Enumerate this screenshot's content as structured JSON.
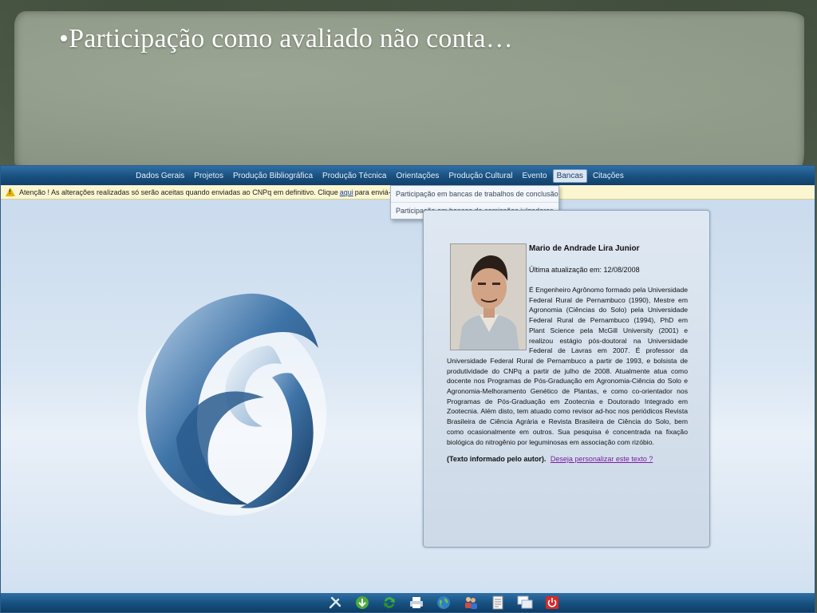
{
  "slide": {
    "title": "•Participação como avaliado não conta…"
  },
  "menu": {
    "items": [
      {
        "label": "Dados Gerais"
      },
      {
        "label": "Projetos"
      },
      {
        "label": "Produção Bibliográfica"
      },
      {
        "label": "Produção Técnica"
      },
      {
        "label": "Orientações"
      },
      {
        "label": "Produção Cultural"
      },
      {
        "label": "Evento"
      },
      {
        "label": "Bancas",
        "active": true
      },
      {
        "label": "Citações"
      }
    ],
    "dropdown": [
      "Participação em bancas de trabalhos de conclusão",
      "Participação em bancas de comissões julgadoras"
    ]
  },
  "notice": {
    "text_before": "Atenção ! As alterações realizadas só serão aceitas quando enviadas ao CNPq em definitivo. Clique",
    "link": "aqui",
    "text_after": "para enviá-las."
  },
  "profile": {
    "name": "Mario de Andrade Lira Junior",
    "updated": "Última atualização em: 12/08/2008",
    "bio": "É Engenheiro Agrônomo formado pela Universidade Federal Rural de Pernambuco (1990), Mestre em Agronomia (Ciências do Solo) pela Universidade Federal Rural de Pernambuco (1994), PhD em Plant Science pela McGill University (2001) e realizou estágio pós-doutoral na Universidade Federal de Lavras em 2007. É professor da Universidade Federal Rural de Pernambuco a partir de 1993, e bolsista de produtividade do CNPq a partir de julho de 2008. Atualmente atua como docente nos Programas de Pós-Graduação em Agronomia-Ciência do Solo e Agronomia-Melhoramento Genético de Plantas, e como co-orientador nos Programas de Pós-Graduação em Zootecnia e Doutorado Integrado em Zootecnia. Além disto, tem atuado como revisor ad-hoc nos periódicos Revista Brasileira de Ciência Agrária e Revista Brasileira de Ciência do Solo, bem como ocasionalmente em outros. Sua pesquisa é concentrada na fixação biológica do nitrogênio por leguminosas em associação com rizóbio.",
    "author_note": "(Texto informado pelo autor).",
    "personalize_link": "Deseja personalizar este texto ?"
  },
  "toolbar": {
    "icons": [
      "tools-icon",
      "download-icon",
      "refresh-icon",
      "print-icon",
      "globe-icon",
      "users-icon",
      "document-icon",
      "windows-icon",
      "power-icon"
    ]
  },
  "colors": {
    "menubar": "#19507f",
    "notice_bg": "#fbf6cf",
    "link": "#1a3fa8",
    "visited_link": "#7a1fa0"
  }
}
